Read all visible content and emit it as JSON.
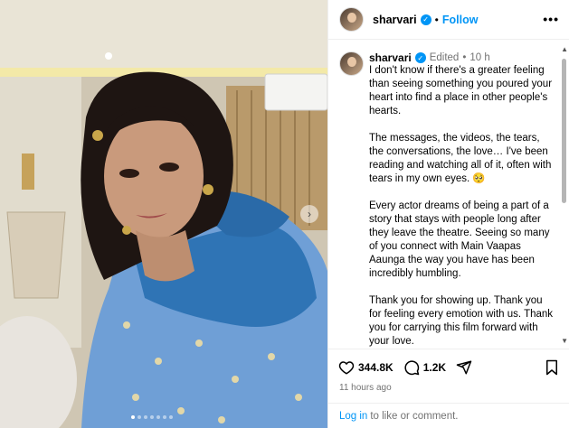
{
  "post": {
    "next_icon": "chevron-right-icon",
    "carousel_dot_count": 7,
    "carousel_active_index": 0
  },
  "header": {
    "username": "sharvari",
    "separator": "•",
    "follow_label": "Follow",
    "more_icon": "more-horizontal-icon"
  },
  "caption": {
    "username": "sharvari",
    "edited_label": "Edited",
    "separator": "•",
    "age": "10 h",
    "paragraphs": [
      "I don't know if there's a greater feeling than seeing something you poured your heart into find a place in other people's hearts.",
      "The messages, the videos, the tears, the conversations, the love… I've been reading and watching all of it, often with tears in my own eyes. 🥺",
      "Every actor dreams of being a part of a story that stays with people long after they leave the theatre. Seeing so many of you connect with Main Vaapas Aaunga the way you have has been incredibly humbling.",
      "Thank you for showing up. Thank you for feeling every emotion with us. Thank you for carrying this film forward with your love."
    ]
  },
  "actions": {
    "likes": "344.8K",
    "comments": "1.2K",
    "timestamp": "11 hours ago"
  },
  "login": {
    "link": "Log in",
    "text": "to like or comment."
  },
  "colors": {
    "accent": "#0095f6",
    "muted": "#737373",
    "border": "#efefef"
  }
}
